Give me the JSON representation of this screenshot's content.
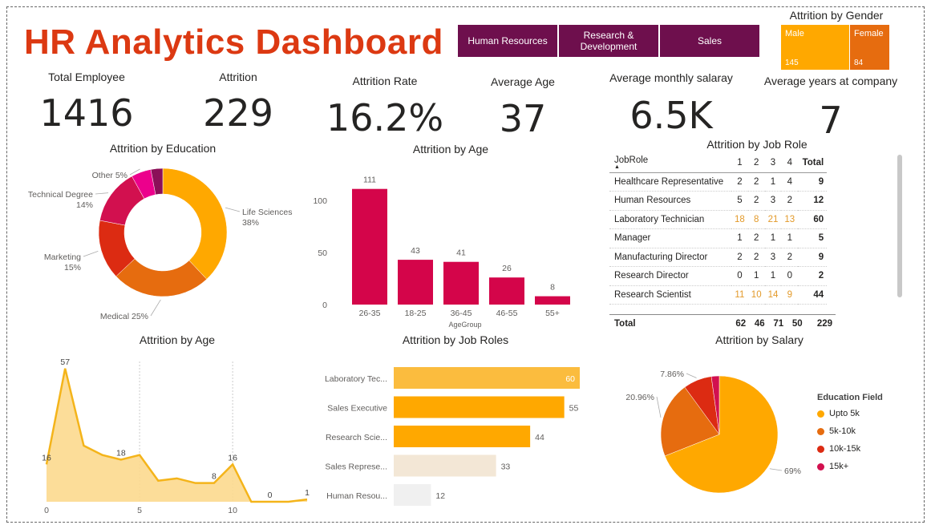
{
  "header": {
    "title": "HR Analytics Dashboard"
  },
  "slicers": [
    "Human Resources",
    "Research & Development",
    "Sales"
  ],
  "kpis": {
    "total_employee": {
      "label": "Total Employee",
      "value": "1416"
    },
    "attrition": {
      "label": "Attrition",
      "value": "229"
    },
    "attrition_rate": {
      "label": "Attrition Rate",
      "value": "16.2%"
    },
    "average_age": {
      "label": "Average Age",
      "value": "37"
    },
    "avg_salary": {
      "label": "Average monthly salaray",
      "value": "6.5K"
    },
    "avg_years": {
      "label": "Average years at company",
      "value": "7"
    }
  },
  "gender": {
    "title": "Attrition by Gender",
    "male_label": "Male",
    "male_value": "145",
    "female_label": "Female",
    "female_value": "84",
    "colors": {
      "male": "#ffa800",
      "female": "#e66c0f"
    }
  },
  "job_role_table": {
    "title": "Attrition by Job Role",
    "columns": [
      "JobRole",
      "1",
      "2",
      "3",
      "4",
      "Total"
    ],
    "rows": [
      [
        "Healthcare Representative",
        "2",
        "2",
        "1",
        "4",
        "9"
      ],
      [
        "Human Resources",
        "5",
        "2",
        "3",
        "2",
        "12"
      ],
      [
        "Laboratory Technician",
        "18",
        "8",
        "21",
        "13",
        "60"
      ],
      [
        "Manager",
        "1",
        "2",
        "1",
        "1",
        "5"
      ],
      [
        "Manufacturing Director",
        "2",
        "2",
        "3",
        "2",
        "9"
      ],
      [
        "Research Director",
        "0",
        "1",
        "1",
        "0",
        "2"
      ],
      [
        "Research Scientist",
        "11",
        "10",
        "14",
        "9",
        "44"
      ]
    ],
    "total_row": [
      "Total",
      "62",
      "46",
      "71",
      "50",
      "229"
    ]
  },
  "chart_data": [
    {
      "id": "education",
      "type": "pie",
      "title": "Attrition by Education",
      "donut": true,
      "slices": [
        {
          "label": "Life Sciences",
          "value": 38,
          "display": "Life Sciences\n38%",
          "color": "#ffa800"
        },
        {
          "label": "Medical",
          "value": 25,
          "display": "Medical 25%",
          "color": "#e66c0f"
        },
        {
          "label": "Marketing",
          "value": 15,
          "display": "Marketing\n15%",
          "color": "#dc2b12"
        },
        {
          "label": "Technical Degree",
          "value": 14,
          "display": "Technical Degree\n14%",
          "color": "#d2104f"
        },
        {
          "label": "Other",
          "value": 5,
          "display": "Other 5%",
          "color": "#ec008c"
        },
        {
          "label": "",
          "value": 3,
          "display": "",
          "color": "#8b0f58"
        }
      ]
    },
    {
      "id": "age_group",
      "type": "bar",
      "title": "Attrition by Age",
      "xlabel": "AgeGroup",
      "categories": [
        "26-35",
        "18-25",
        "36-45",
        "46-55",
        "55+"
      ],
      "values": [
        111,
        43,
        41,
        26,
        8
      ],
      "yticks": [
        0,
        50,
        100
      ],
      "ylim": [
        0,
        120
      ],
      "color": "#d4054a"
    },
    {
      "id": "age_line",
      "type": "area",
      "title": "Attrition by Age",
      "x": [
        0,
        1,
        2,
        3,
        4,
        5,
        6,
        7,
        8,
        9,
        10,
        11,
        12,
        13,
        14
      ],
      "y": [
        16,
        57,
        24,
        20,
        18,
        20,
        9,
        10,
        8,
        8,
        16,
        0,
        0,
        0,
        1
      ],
      "data_labels": {
        "0": "16",
        "1": "57",
        "4": "18",
        "9": "8",
        "10": "16",
        "12": "0",
        "14": "1"
      },
      "xticks": [
        0,
        5,
        10
      ],
      "ylim": [
        0,
        60
      ],
      "grid": "vertical dotted",
      "color": "#f4b41a"
    },
    {
      "id": "job_roles",
      "type": "bar",
      "orientation": "horizontal",
      "title": "Attrition by Job Roles",
      "categories": [
        "Laboratory Tec...",
        "Sales Executive",
        "Research Scie...",
        "Sales Represe...",
        "Human Resou..."
      ],
      "values": [
        60,
        55,
        44,
        33,
        12
      ],
      "colors": [
        "#fbbc3e",
        "#ffa800",
        "#ffa800",
        "#f3e7d6",
        "#f0f0f0"
      ],
      "xlim": [
        0,
        60
      ]
    },
    {
      "id": "salary",
      "type": "pie",
      "title": "Attrition by Salary",
      "legend_title": "Education Field",
      "legend_position": "right",
      "slices": [
        {
          "label": "Upto 5k",
          "value": 69,
          "display": "69%",
          "color": "#ffa800"
        },
        {
          "label": "5k-10k",
          "value": 20.96,
          "display": "20.96%",
          "color": "#e66c0f"
        },
        {
          "label": "10k-15k",
          "value": 7.86,
          "display": "7.86%",
          "color": "#dc2b12"
        },
        {
          "label": "15k+",
          "value": 2.18,
          "display": "",
          "color": "#d2104f"
        }
      ]
    }
  ]
}
